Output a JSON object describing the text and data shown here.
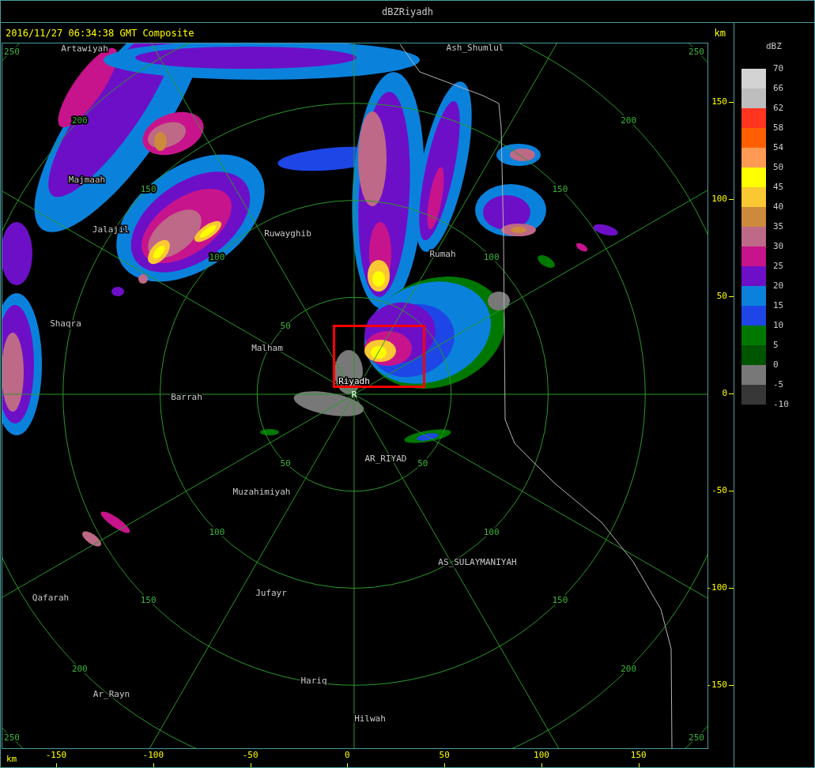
{
  "window": {
    "title": "dBZRiyadh"
  },
  "header": {
    "timestamp": "2016/11/27 06:34:38 GMT Composite",
    "unit": "km"
  },
  "map": {
    "site_marker": "R",
    "places": [
      {
        "name": "Artawiyah",
        "kind": "town"
      },
      {
        "name": "Ash_Shumlul",
        "kind": "town"
      },
      {
        "name": "Majmaah",
        "kind": "town"
      },
      {
        "name": "Jalajil",
        "kind": "town"
      },
      {
        "name": "Ruwayghib",
        "kind": "town"
      },
      {
        "name": "Rumah",
        "kind": "town"
      },
      {
        "name": "Shaqra",
        "kind": "town"
      },
      {
        "name": "Malham",
        "kind": "town"
      },
      {
        "name": "Riyadh",
        "kind": "site"
      },
      {
        "name": "Barrah",
        "kind": "town"
      },
      {
        "name": "AR_RIYAD",
        "kind": "town"
      },
      {
        "name": "Muzahimiyah",
        "kind": "town"
      },
      {
        "name": "AS_SULAYMANIYAH",
        "kind": "town"
      },
      {
        "name": "Qafarah",
        "kind": "town"
      },
      {
        "name": "Jufayr",
        "kind": "town"
      },
      {
        "name": "Hariq",
        "kind": "town"
      },
      {
        "name": "Ar_Rayn",
        "kind": "town"
      },
      {
        "name": "Hilwah",
        "kind": "town"
      }
    ],
    "range_rings": [
      {
        "labels": [
          "50",
          "50",
          "50"
        ]
      },
      {
        "labels": [
          "100",
          "100",
          "100",
          "100"
        ]
      },
      {
        "labels": [
          "150",
          "150",
          "150",
          "150"
        ]
      },
      {
        "labels": [
          "200",
          "200",
          "200",
          "200"
        ]
      },
      {
        "labels": [
          "250",
          "250",
          "250",
          "250"
        ]
      }
    ]
  },
  "y_axis": {
    "ticks": [
      "150",
      "100",
      "50",
      "0",
      "-50",
      "-100",
      "-150"
    ]
  },
  "x_axis": {
    "unit": "km",
    "ticks": [
      "-150",
      "-100",
      "-50",
      "0",
      "50",
      "100",
      "150"
    ]
  },
  "legend": {
    "title": "dBZ",
    "labels": [
      "70",
      "66",
      "62",
      "58",
      "54",
      "50",
      "45",
      "40",
      "35",
      "30",
      "25",
      "20",
      "15",
      "10",
      "5",
      "0",
      "-5",
      "-10"
    ],
    "bins": [
      {
        "color": "#d3d3d3"
      },
      {
        "color": "#bebebe"
      },
      {
        "color": "#ff3520"
      },
      {
        "color": "#ff5f00"
      },
      {
        "color": "#ff9a55"
      },
      {
        "color": "#ffff00"
      },
      {
        "color": "#fac832"
      },
      {
        "color": "#cd8a3c"
      },
      {
        "color": "#be6987"
      },
      {
        "color": "#c8148c"
      },
      {
        "color": "#6e0fc8"
      },
      {
        "color": "#0a82dc"
      },
      {
        "color": "#1e46e6"
      },
      {
        "color": "#007800"
      },
      {
        "color": "#005500"
      },
      {
        "color": "#787878"
      },
      {
        "color": "#373737"
      }
    ]
  }
}
